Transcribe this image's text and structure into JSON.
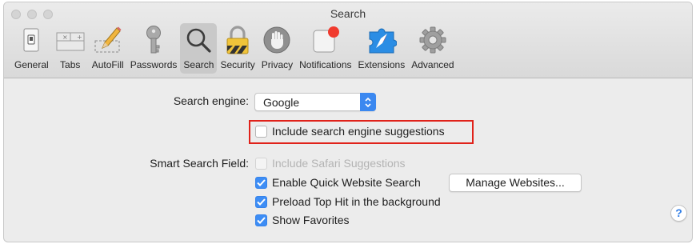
{
  "window": {
    "title": "Search"
  },
  "toolbar": {
    "items": [
      {
        "label": "General",
        "icon": "general-switch-icon"
      },
      {
        "label": "Tabs",
        "icon": "tabs-icon"
      },
      {
        "label": "AutoFill",
        "icon": "autofill-pencil-icon"
      },
      {
        "label": "Passwords",
        "icon": "key-icon"
      },
      {
        "label": "Search",
        "icon": "magnifier-icon",
        "selected": true
      },
      {
        "label": "Security",
        "icon": "padlock-icon"
      },
      {
        "label": "Privacy",
        "icon": "hand-icon"
      },
      {
        "label": "Notifications",
        "icon": "notification-badge-icon"
      },
      {
        "label": "Extensions",
        "icon": "puzzle-compass-icon"
      },
      {
        "label": "Advanced",
        "icon": "gear-icon"
      }
    ]
  },
  "search": {
    "engine_label": "Search engine:",
    "engine_value": "Google",
    "include_suggestions": {
      "label": "Include search engine suggestions",
      "checked": false
    }
  },
  "smart_search": {
    "label": "Smart Search Field:",
    "include_safari": {
      "label": "Include Safari Suggestions",
      "checked": false,
      "disabled": true
    },
    "quick_website": {
      "label": "Enable Quick Website Search",
      "checked": true
    },
    "manage_button": "Manage Websites...",
    "preload": {
      "label": "Preload Top Hit in the background",
      "checked": true
    },
    "favorites": {
      "label": "Show Favorites",
      "checked": true
    }
  },
  "help": {
    "label": "?"
  },
  "colors": {
    "accent": "#3d8df5",
    "highlight": "#e0221a",
    "selected_tab": "#c9c9c9"
  }
}
